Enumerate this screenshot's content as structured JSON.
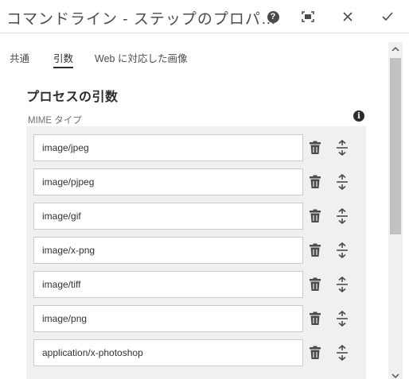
{
  "dialog": {
    "title": "コマンドライン - ステップのプロパ…",
    "help_label": "?",
    "buttons": [
      "help-icon",
      "fullscreen-icon",
      "close-icon",
      "checkmark-icon"
    ]
  },
  "tabs": [
    {
      "label": "共通",
      "active": false
    },
    {
      "label": "引数",
      "active": true
    },
    {
      "label": "Web に対応した画像",
      "active": false
    }
  ],
  "section": {
    "title": "プロセスの引数",
    "field_label": "MIME タイプ",
    "info_label": "i"
  },
  "mime_types": [
    "image/jpeg",
    "image/pjpeg",
    "image/gif",
    "image/x-png",
    "image/tiff",
    "image/png",
    "application/x-photoshop"
  ],
  "colors": {
    "text": "#323232",
    "panel": "#f0f0f0",
    "border": "#cacaca",
    "icon": "#4b4b4b"
  }
}
